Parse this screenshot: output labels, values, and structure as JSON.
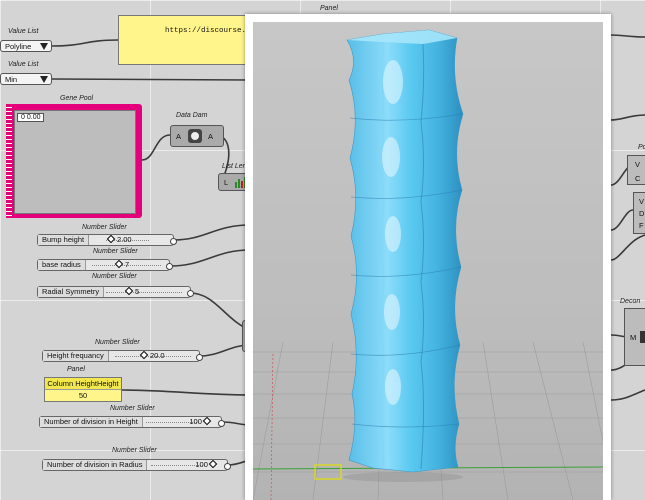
{
  "value_list_1": {
    "title": "Value List",
    "selected": "Polyline"
  },
  "value_list_2": {
    "title": "Value List",
    "selected": "Min"
  },
  "top_panel": {
    "title": "Panel",
    "text": "https://discourse.m"
  },
  "gene_pool": {
    "title": "Gene Pool",
    "index": "0",
    "value": "0.00"
  },
  "data_dam": {
    "title": "Data Dam",
    "input": "A",
    "output": "A"
  },
  "list_length": {
    "title": "List Len",
    "input": "L"
  },
  "sliders": [
    {
      "title": "Number Slider",
      "label": "Bump height",
      "value": "2.00"
    },
    {
      "title": "Number Slider",
      "label": "base radius",
      "value": "7"
    },
    {
      "title": "Number Slider",
      "label": "Radial Symmetry",
      "value": "5"
    },
    {
      "title": "Number Slider",
      "label": "Height frequancy",
      "value": "20.0"
    },
    {
      "title": "Number Slider",
      "label": "Number of division in Height",
      "value": "100"
    },
    {
      "title": "Number Slider",
      "label": "Number of division in Radius",
      "value": "100"
    }
  ],
  "column_panel": {
    "title": "Panel",
    "header": "Column HeightHeight",
    "value": "50"
  },
  "right_comp_1": {
    "title": "Po",
    "inputs": [
      "V",
      "C"
    ]
  },
  "right_comp_2": {
    "title": "Decon",
    "input": "M"
  },
  "colors": {
    "canvas": "#d4d4d4",
    "gene_pool": "#e3007a",
    "panel": "#fff58a",
    "mesh": "#5cc8ee"
  }
}
